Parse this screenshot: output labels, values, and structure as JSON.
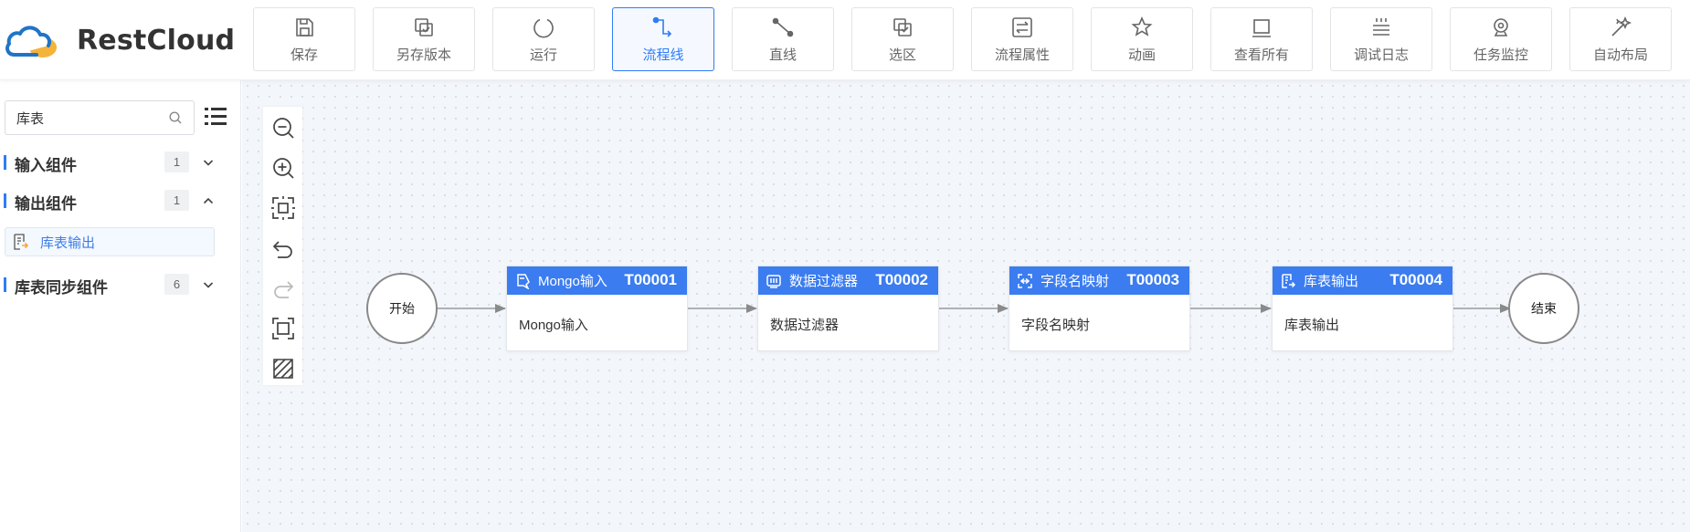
{
  "app": {
    "logo_text": "RestCloud",
    "accent": "#2f7cf6"
  },
  "toolbar": [
    {
      "label": "保存",
      "icon": "save-icon"
    },
    {
      "label": "另存版本",
      "icon": "save-version-icon"
    },
    {
      "label": "运行",
      "icon": "run-icon"
    },
    {
      "label": "流程线",
      "icon": "flow-line-icon",
      "active": true
    },
    {
      "label": "直线",
      "icon": "straight-line-icon"
    },
    {
      "label": "选区",
      "icon": "selection-icon"
    },
    {
      "label": "流程属性",
      "icon": "process-properties-icon"
    },
    {
      "label": "动画",
      "icon": "animation-icon"
    },
    {
      "label": "查看所有",
      "icon": "view-all-icon"
    },
    {
      "label": "调试日志",
      "icon": "debug-log-icon"
    },
    {
      "label": "任务监控",
      "icon": "task-monitor-icon"
    },
    {
      "label": "自动布局",
      "icon": "auto-layout-icon"
    }
  ],
  "sidebar": {
    "search": {
      "value": "库表",
      "placeholder": ""
    },
    "groups": [
      {
        "title": "输入组件",
        "count": "1",
        "expanded": false
      },
      {
        "title": "输出组件",
        "count": "1",
        "expanded": true,
        "items": [
          {
            "label": "库表输出"
          }
        ]
      },
      {
        "title": "库表同步组件",
        "count": "6",
        "expanded": false
      }
    ]
  },
  "flow": {
    "start": {
      "label": "开始"
    },
    "end": {
      "label": "结束"
    },
    "nodes": [
      {
        "name": "Mongo输入",
        "id": "T00001",
        "body": "Mongo输入",
        "icon": "mongo-icon"
      },
      {
        "name": "数据过滤器",
        "id": "T00002",
        "body": "数据过滤器",
        "icon": "filter-icon"
      },
      {
        "name": "字段名映射",
        "id": "T00003",
        "body": "字段名映射",
        "icon": "mapping-icon"
      },
      {
        "name": "库表输出",
        "id": "T00004",
        "body": "库表输出",
        "icon": "table-output-icon"
      }
    ]
  }
}
